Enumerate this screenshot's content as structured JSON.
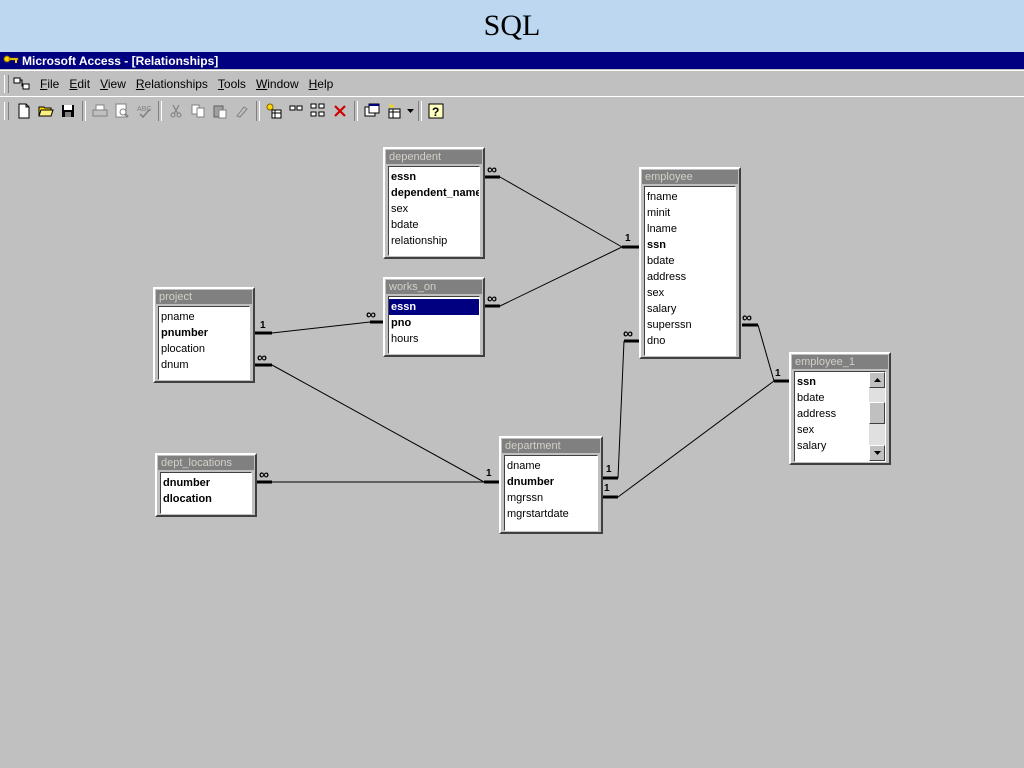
{
  "slide": {
    "title": "SQL"
  },
  "window": {
    "title": "Microsoft Access - [Relationships]"
  },
  "menu": [
    {
      "label": "File"
    },
    {
      "label": "Edit"
    },
    {
      "label": "View"
    },
    {
      "label": "Relationships"
    },
    {
      "label": "Tools"
    },
    {
      "label": "Window"
    },
    {
      "label": "Help"
    }
  ],
  "toolbar": [
    "new-icon",
    "open-icon",
    "save-icon",
    "print-icon",
    "print-preview-icon",
    "spelling-icon",
    "cut-icon",
    "copy-icon",
    "paste-icon",
    "format-painter-icon",
    "show-table-icon",
    "show-direct-icon",
    "show-all-icon",
    "delete-icon",
    "database-window-icon",
    "new-object-icon",
    "help-icon"
  ],
  "tables": {
    "dependent": {
      "title": "dependent",
      "fields": [
        "essn",
        "dependent_name",
        "sex",
        "bdate",
        "relationship"
      ],
      "keys": [
        0,
        1
      ]
    },
    "works_on": {
      "title": "works_on",
      "fields": [
        "essn",
        "pno",
        "hours"
      ],
      "keys": [
        0,
        1
      ],
      "selected": 0
    },
    "project": {
      "title": "project",
      "fields": [
        "pname",
        "pnumber",
        "plocation",
        "dnum"
      ],
      "keys": [
        1
      ]
    },
    "employee": {
      "title": "employee",
      "fields": [
        "fname",
        "minit",
        "lname",
        "ssn",
        "bdate",
        "address",
        "sex",
        "salary",
        "superssn",
        "dno"
      ],
      "keys": [
        3
      ]
    },
    "dept_locations": {
      "title": "dept_locations",
      "fields": [
        "dnumber",
        "dlocation"
      ],
      "keys": [
        0,
        1
      ]
    },
    "department": {
      "title": "department",
      "fields": [
        "dname",
        "dnumber",
        "mgrssn",
        "mgrstartdate"
      ],
      "keys": [
        1
      ]
    },
    "employee_1": {
      "title": "employee_1",
      "fields": [
        "ssn",
        "bdate",
        "address",
        "sex",
        "salary"
      ],
      "keys": [
        0
      ]
    }
  },
  "cardinality": {
    "one": "1",
    "many": "∞"
  }
}
